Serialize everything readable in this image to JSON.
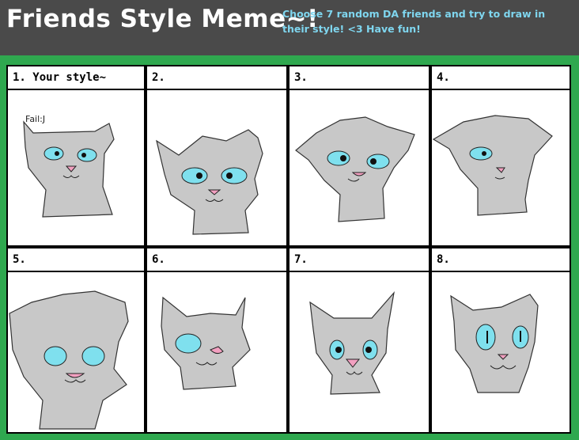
{
  "header": {
    "title": "Friends Style Meme~!",
    "subtitle": "Choose 7 random DA friends and try to draw in their style! <3 Have fun!"
  },
  "panels": [
    {
      "label": "1. Your style~",
      "doodle": "Fail:J"
    },
    {
      "label": "2."
    },
    {
      "label": "3."
    },
    {
      "label": "4."
    },
    {
      "label": "5."
    },
    {
      "label": "6."
    },
    {
      "label": "7."
    },
    {
      "label": "8."
    }
  ],
  "colors": {
    "background": "#2fa84f",
    "header": "#4a4a4a",
    "title": "#ffffff",
    "subtitle": "#7fd6ef",
    "fur": "#c8c8c8",
    "eye": "#7fe0ee",
    "nose": "#f2a0c0"
  }
}
